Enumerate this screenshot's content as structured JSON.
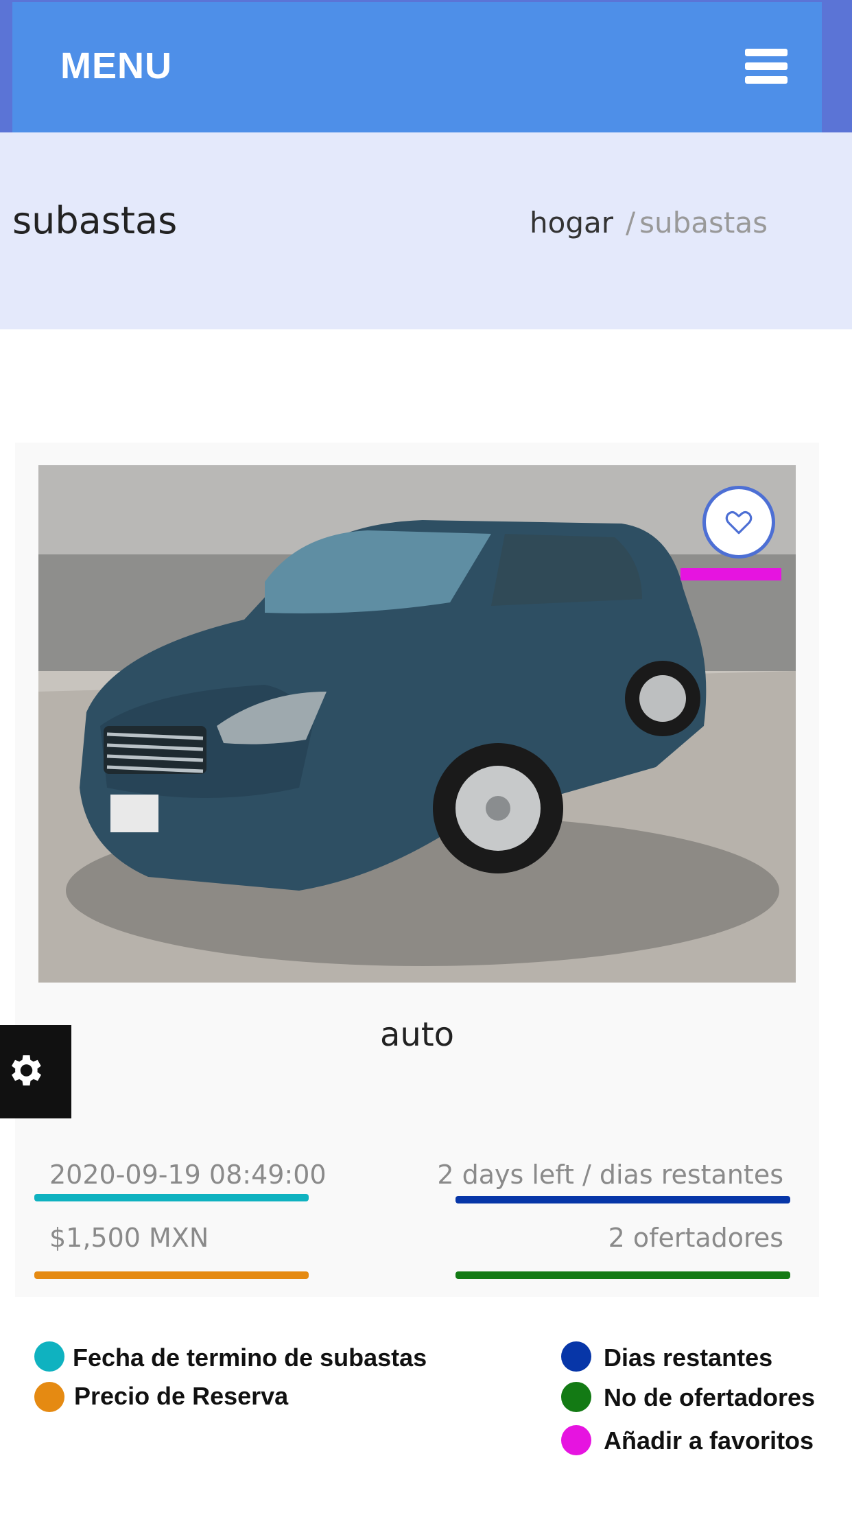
{
  "header": {
    "menu_label": "MENU",
    "menu_icon": "hamburger-menu-icon"
  },
  "page": {
    "title": "subastas",
    "breadcrumb": {
      "home": "hogar",
      "separator": "/",
      "current": "subastas"
    }
  },
  "auction_card": {
    "image_alt": "car photo",
    "favorite_icon": "heart-icon",
    "title": "auto",
    "end_date": "2020-09-19 08:49:00",
    "days_left": "2 days left / dias restantes",
    "reserve_price": "$1,500 MXN",
    "bidders": "2 ofertadores"
  },
  "settings": {
    "icon": "gear-icon"
  },
  "legend": [
    {
      "label": "Fecha  de termino de subastas",
      "color": "#0fb2c0"
    },
    {
      "label": "Precio de Reserva",
      "color": "#e58a12"
    },
    {
      "label": "Dias restantes",
      "color": "#0736a8"
    },
    {
      "label": "No de ofertadores",
      "color": "#137a14"
    },
    {
      "label": "Añadir a favoritos",
      "color": "#e614e0"
    }
  ],
  "colors": {
    "navbar": "#4e8fe8",
    "breadcrumb_band": "#e4e9fb",
    "favorite_marker": "#e614e0"
  }
}
